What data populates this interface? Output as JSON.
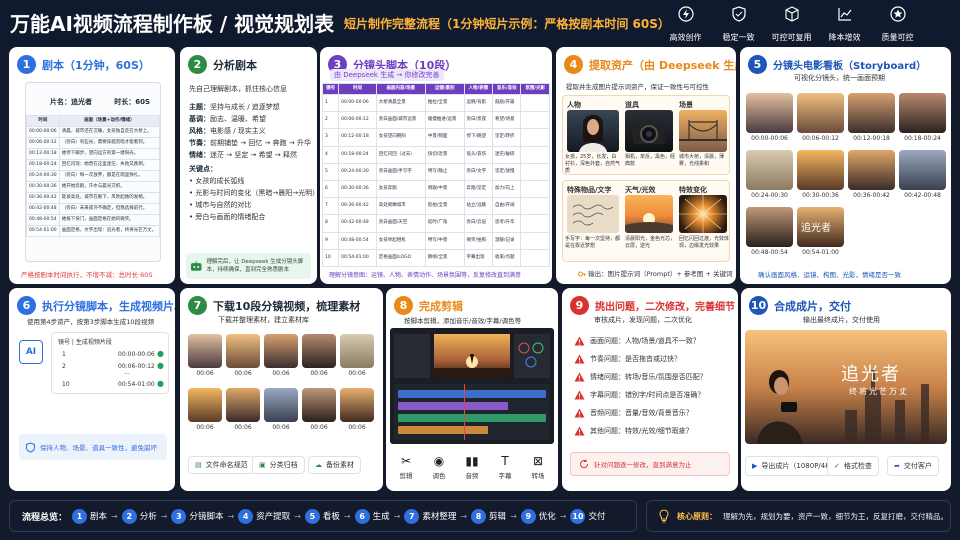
{
  "header": {
    "title": "万能AI视频流程制作板 / 视觉规划表",
    "subtitle": "短片制作完整流程（1分钟短片示例：严格按剧本时间 60S）",
    "features": [
      {
        "icon": "lightning-icon",
        "label": "高效创作"
      },
      {
        "icon": "shield-icon",
        "label": "稳定一致"
      },
      {
        "icon": "cube-icon",
        "label": "可控可复用"
      },
      {
        "icon": "chart-icon",
        "label": "降本增效"
      },
      {
        "icon": "star-icon",
        "label": "质量可控"
      }
    ]
  },
  "colors": {
    "blue": "#2f6fe0",
    "green": "#2e8b46",
    "purple": "#6d3fc0",
    "orange": "#e88a1a",
    "navy": "#1e56b8",
    "red": "#d9322f"
  },
  "p1": {
    "num": "1",
    "title": "剧本（1分钟，60S）",
    "film_label": "片名：追光者",
    "len_label": "时长：60S",
    "cols": [
      "时间",
      "画面（场景+动作/情绪）"
    ],
    "rows": [
      [
        "00:00-00:06",
        "清晨，城市还在沉睡，女孩独自走在大桥上。"
      ],
      [
        "00:06-00:12",
        "（旁白）有些光，需要穿越黑暗才能看到。"
      ],
      [
        "00:12-00:18",
        "她停下脚步，望向远方的第一缕阳光。"
      ],
      [
        "00:18-00:24",
        "回忆闪现：她曾在这里迷茫，失败又跌倒。"
      ],
      [
        "00:24-00:30",
        "（旁白）每一次放弃，都是在雨里挣扎。"
      ],
      [
        "00:30-00:36",
        "她开始奔跑，汗水与晨光交织。"
      ],
      [
        "00:36-00:42",
        "陡坡高处，城市在眼下，风吹起她的发梢。"
      ],
      [
        "00:42-00:48",
        "（旁白）未来或许不确定，但我选择前行。"
      ],
      [
        "00:48-00:54",
        "她按下快门，画面定格在她的微笑。"
      ],
      [
        "00:54-01:00",
        "画面定格，文字出现：追光者，终将光芒万丈。"
      ]
    ],
    "note": "严格按剧本时间执行，不增不减：总时长 60S"
  },
  "p2": {
    "num": "2",
    "title": "分析剧本",
    "sub": "先自己理解剧本，抓住核心信息",
    "items": [
      {
        "k": "主题：",
        "v": "坚持与成长 / 追逐梦想"
      },
      {
        "k": "基调：",
        "v": "励志、温暖、希望"
      },
      {
        "k": "风格：",
        "v": "电影感 / 现实主义"
      },
      {
        "k": "节奏：",
        "v": "前期铺垫 → 回忆 → 奔跑 → 升华"
      },
      {
        "k": "情绪：",
        "v": "迷茫 → 坚定 → 希望 → 释然"
      }
    ],
    "key_title": "关键点：",
    "keys": [
      "• 女孩的成长弧线",
      "• 光影与时间的变化（黑暗→晨阳→光明）",
      "• 城市与自然的对比",
      "• 旁白与画面的情绪配合"
    ],
    "tip": "理解完后，让 Deepseek 生成分镜头脚本，持续确保，直到完全熟悉剧本"
  },
  "p3": {
    "num": "3",
    "title": "分镜头脚本（10段）",
    "sub": "由 Deepseek 生成 → 你修改完善",
    "cols": [
      "镜号",
      "时间",
      "画面内容/场景",
      "运镜/景别",
      "人物/表情",
      "音乐/音效",
      "氛围/光影"
    ],
    "rows": [
      [
        "1",
        "00:00-00:06",
        "大桥清晨全景",
        "推拉/全景",
        "远眺/背影",
        "鼓励/开篇"
      ],
      [
        "2",
        "00:06-00:12",
        "旁白画面/城市远景",
        "缓慢推进/远景",
        "旁白/黑夜",
        "希望/诗意"
      ],
      [
        "3",
        "00:12-00:18",
        "女孩望向朝阳",
        "中景/侧面",
        "停下/眺望",
        "坚定/转折"
      ],
      [
        "4",
        "00:18-00:24",
        "回忆闪回（过去）",
        "快切/近景",
        "低头/哀伤",
        "迷茫/破碎"
      ],
      [
        "5",
        "00:24-00:30",
        "旁白画面/手写字",
        "特写/静止",
        "旁白/文字",
        "坚定/放慢"
      ],
      [
        "6",
        "00:30-00:36",
        "女孩奔跑",
        "侧跟/中景",
        "奔跑/坚定",
        "加力/向上"
      ],
      [
        "7",
        "00:36-00:42",
        "高处俯瞰城市",
        "航拍/全景",
        "站立/远眺",
        "自由/开阔"
      ],
      [
        "8",
        "00:42-00:48",
        "旁白画面/天空",
        "延时/广角",
        "旁白/云层",
        "思考/升华"
      ],
      [
        "9",
        "00:48-00:54",
        "女孩举起相机",
        "特写/中景",
        "微笑/拍照",
        "温暖/记录"
      ],
      [
        "10",
        "00:54-01:00",
        "定格画面/LOGO",
        "静帧/全景",
        "字幕出现",
        "收束/点题"
      ]
    ],
    "note": "理解分镜意图：运镜、人物、表情动作、场景氛围等，反复修改直到满意"
  },
  "p4": {
    "num": "4",
    "title": "提取资产（由 Deepseek 生成）",
    "sub": "提取并生成图片提示词资产，保证一致性与可控性",
    "labels": [
      "人物",
      "道具",
      "场景"
    ],
    "caps": [
      "女孩，25岁，长发，白衬衫，深色外套，自然气质",
      "相机，单反，黑色，经典款",
      "城市大桥，清晨，薄雾，光线柔和"
    ],
    "labels2": [
      "特殊物品/文字",
      "天气/光效",
      "特效变化"
    ],
    "caps2": [
      "手写字：每一次坚持，都是在靠近梦想",
      "清晨阳光，金色光芯，云层，逆光",
      "回忆闪回过渡，光效体现，边缘发光效果"
    ],
    "note": "输出：图片提示词（Prompt）+ 参考图 + 关键词"
  },
  "p5": {
    "num": "5",
    "title": "分镜头电影看板（Storyboard）",
    "sub": "可视化分镜头，统一画面预期",
    "times": [
      "00:00-00:06",
      "00:06-00:12",
      "00:12-00:18",
      "00:18-00:24",
      "00:24-00:30",
      "00:30-00:36",
      "00:36-00:42",
      "00:42-00:48",
      "00:48-00:54",
      "00:54-01:00"
    ],
    "title_card": "追光者",
    "note": "确认画面风格、运镜、构图、光影，情绪是否一致"
  },
  "p6": {
    "num": "6",
    "title": "执行分镜脚本，生成视频片段",
    "sub": "使用第4步资产，按第3步脚本生成10段视频",
    "ai": "AI",
    "col": "镜号",
    "col2": "生成视频片段",
    "r1": [
      "1",
      "00:00-00:06"
    ],
    "r2": [
      "2",
      "00:06-00:12"
    ],
    "dots": "···",
    "r3": [
      "10",
      "00:54-01:00"
    ],
    "note": "保持人物、场景、道具一致性，避免崩坏"
  },
  "p7": {
    "num": "7",
    "title": "下载10段分镜视频，梳理素材",
    "sub": "下载并整理素材，建立素材库",
    "times": [
      "00:06",
      "00:06",
      "00:06",
      "00:06",
      "00:06",
      "00:06",
      "00:06",
      "00:06",
      "00:06",
      "00:06"
    ],
    "btns": [
      "文件命名规范",
      "分类归档",
      "备份素材"
    ]
  },
  "p8": {
    "num": "8",
    "title": "完成剪辑",
    "sub": "按脚本剪辑，添加音乐/音效/字幕/调色等",
    "tools": [
      "剪辑",
      "调色",
      "音频",
      "字幕",
      "转场"
    ]
  },
  "p9": {
    "num": "9",
    "title": "挑出问题，二次修改，完善细节",
    "sub": "审核成片，发现问题，二次优化",
    "issues": [
      "画面问题：人物/场景/道具不一致？",
      "节奏问题：是否拖沓或过快？",
      "情绪问题：转场/音乐/氛围是否匹配？",
      "字幕问题：错别字/时间点是否准确？",
      "音频问题：音量/音效/背景音乐？",
      "其他问题：特效/光效/细节瑕疵？"
    ],
    "note": "针对问题逐一修改，直到满意为止"
  },
  "p10": {
    "num": "10",
    "title": "合成成片，交付",
    "sub": "输出最终成片，交付使用",
    "film_title": "追光者",
    "film_sub": "终将光芒万丈",
    "btns": [
      "导出成片（1080P/4K）",
      "格式检查",
      "交付客户"
    ]
  },
  "footer": {
    "flow_label": "流程总览：",
    "steps": [
      "剧本",
      "分析",
      "分镜脚本",
      "资产提取",
      "看板",
      "生成",
      "素材整理",
      "剪辑",
      "优化",
      "交付"
    ],
    "core_label": "核心原则：",
    "core_text": "理解为先，规划为要，资产一致，细节为王，反复打磨，交付精品。"
  }
}
